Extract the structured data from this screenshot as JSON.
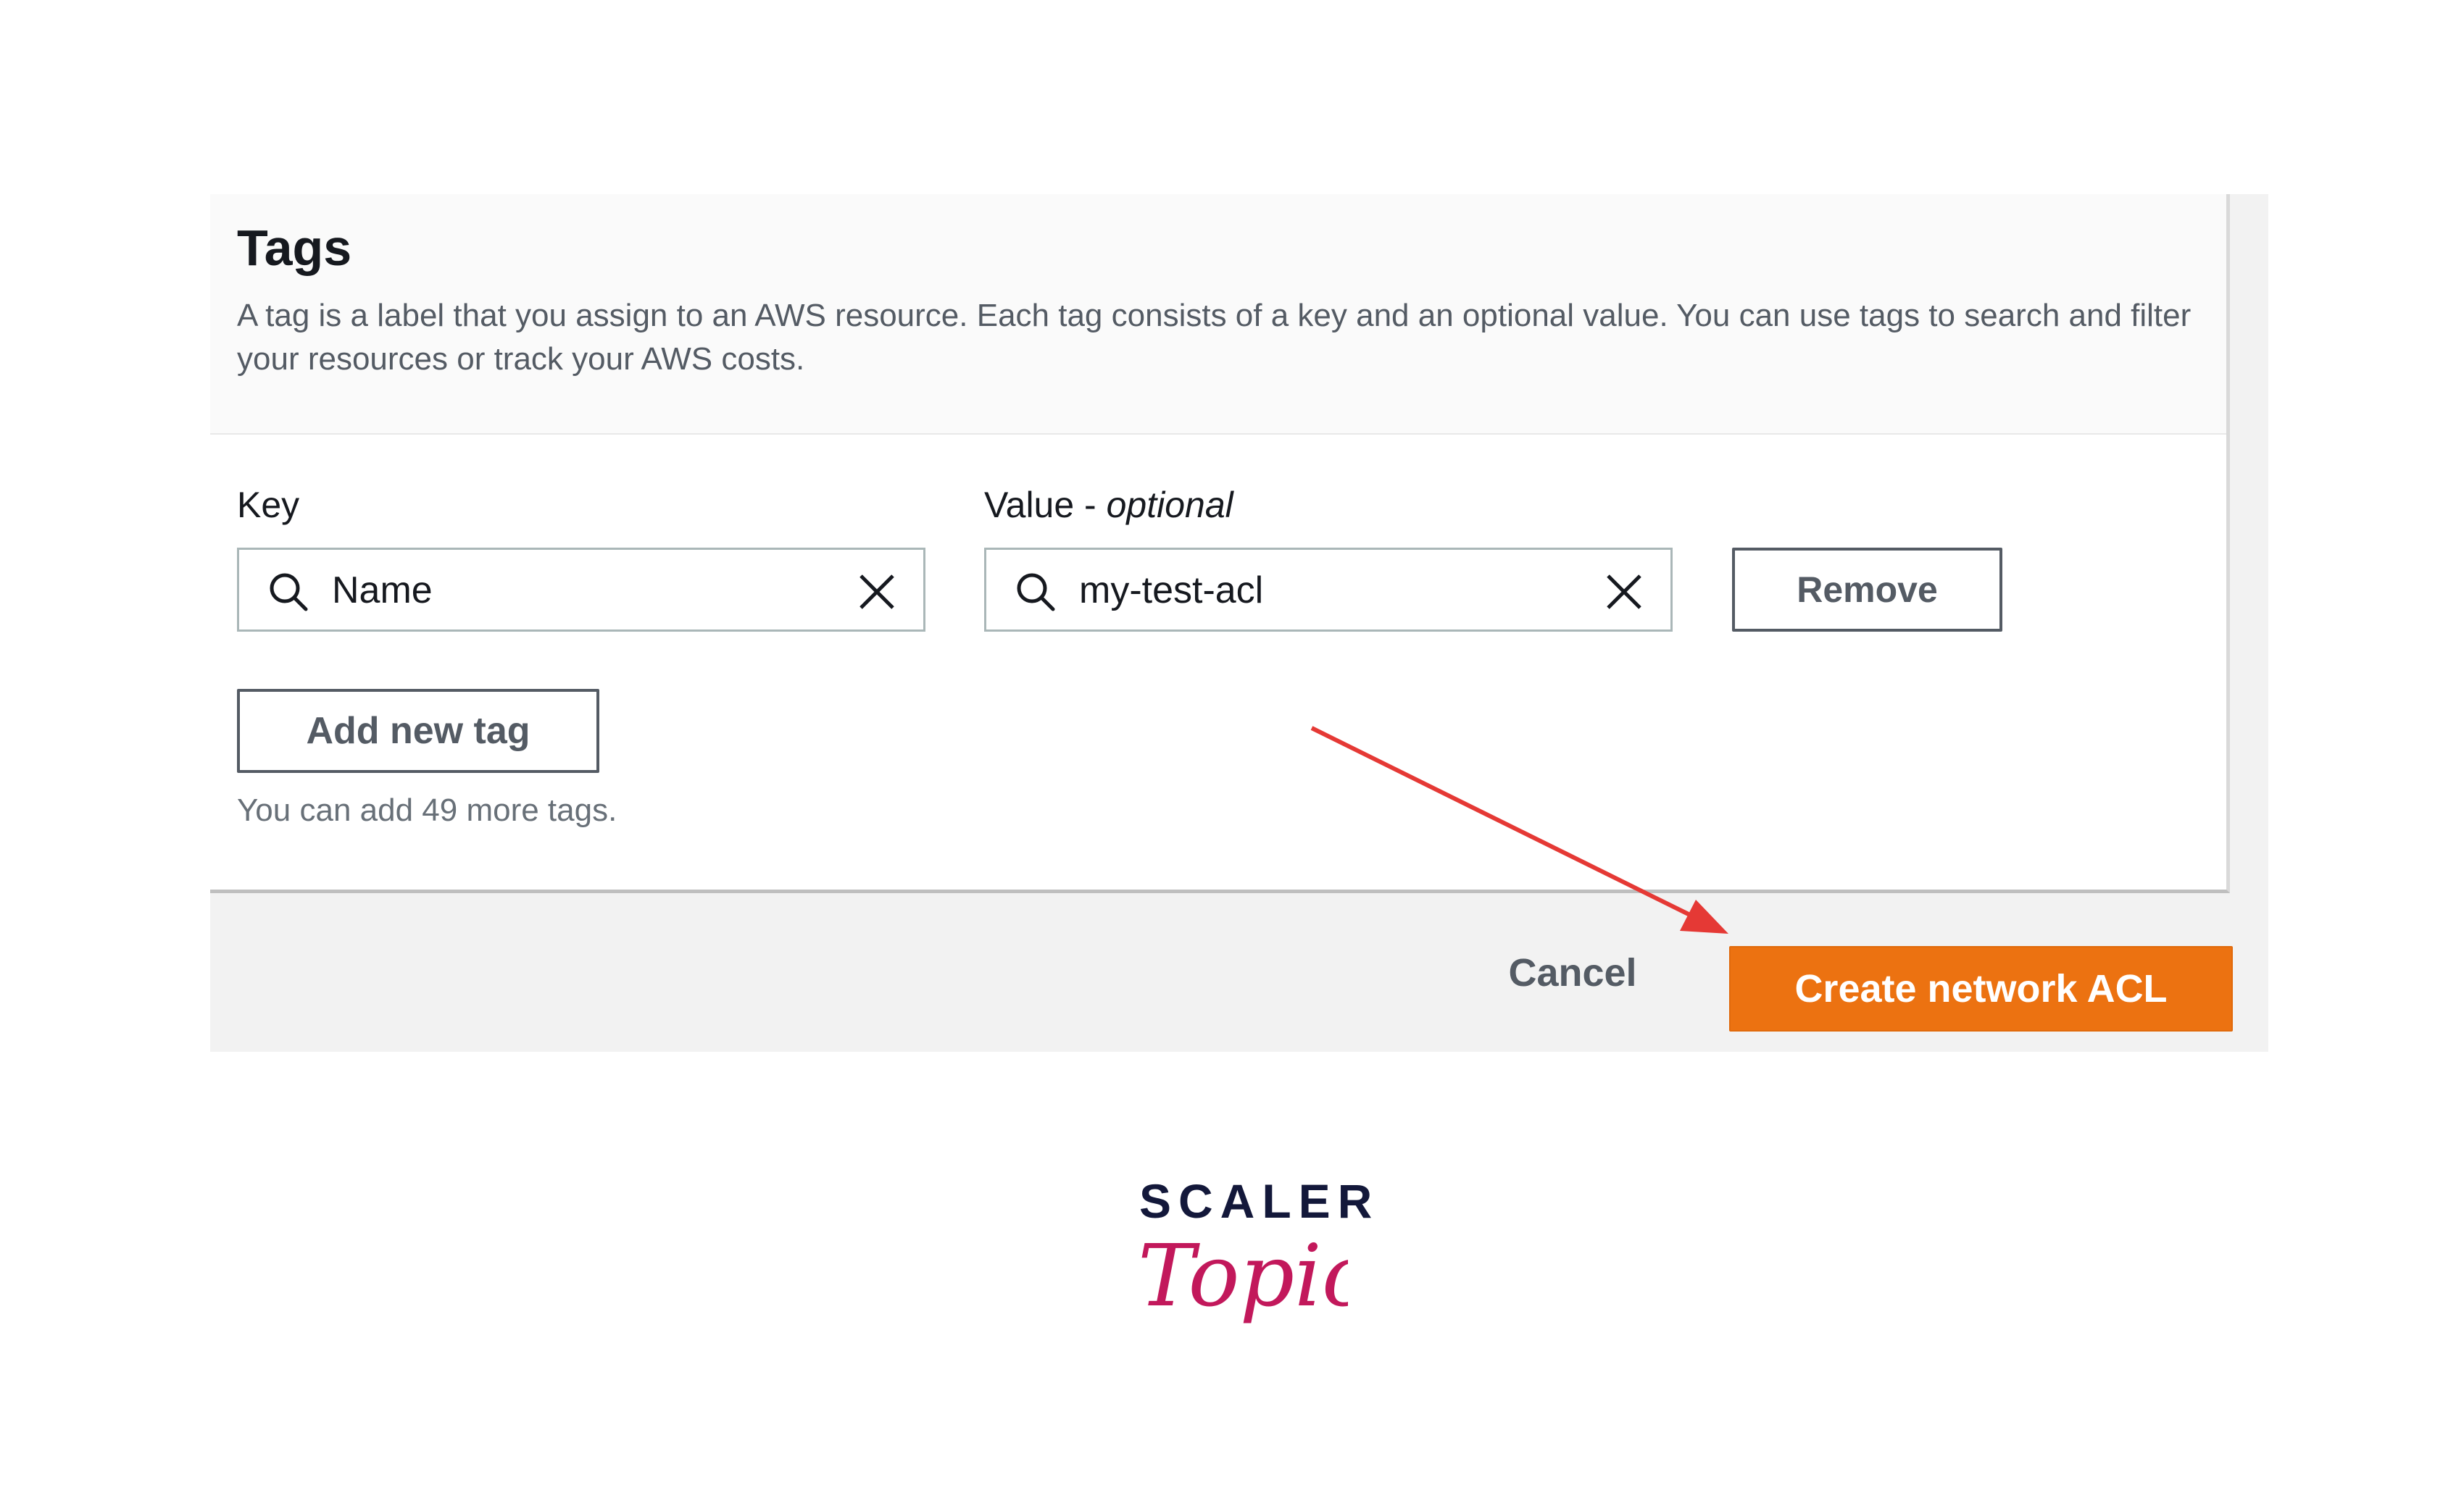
{
  "tags": {
    "title": "Tags",
    "description": "A tag is a label that you assign to an AWS resource. Each tag consists of a key and an optional value. You can use tags to search and filter your resources or track your AWS costs.",
    "key_label": "Key",
    "value_label": "Value - ",
    "value_label_optional": "optional",
    "key_value": "Name",
    "value_value": "my-test-acl",
    "remove_label": "Remove",
    "add_label": "Add new tag",
    "hint": "You can add 49 more tags."
  },
  "footer": {
    "cancel_label": "Cancel",
    "create_label": "Create network ACL"
  },
  "annotation": {
    "arrow_color": "#e53935"
  },
  "colors": {
    "primary": "#ec7211",
    "text_dark": "#16191f",
    "text_muted": "#545b64"
  },
  "icons": {
    "search": "search-icon",
    "clear": "close-icon",
    "arrow": "arrow-icon"
  },
  "logo": {
    "word": "SCALER",
    "script": "Topics",
    "word_color": "#13183a",
    "script_color": "#c2185b"
  }
}
